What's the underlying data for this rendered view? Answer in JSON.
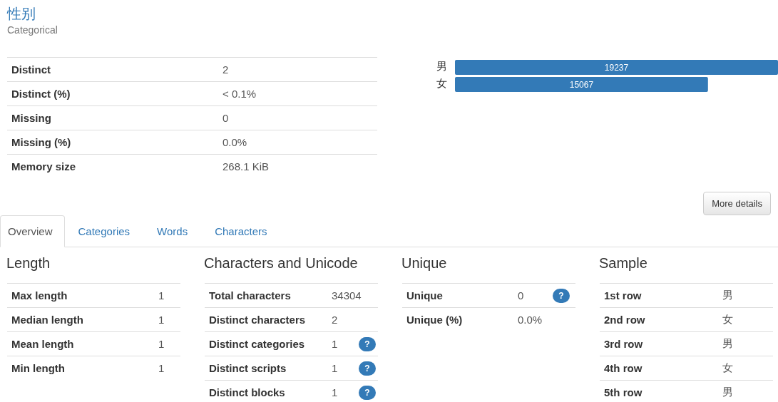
{
  "variable": {
    "name": "性别",
    "type": "Categorical"
  },
  "stats": [
    {
      "label": "Distinct",
      "value": "2"
    },
    {
      "label": "Distinct (%)",
      "value": "< 0.1%"
    },
    {
      "label": "Missing",
      "value": "0"
    },
    {
      "label": "Missing (%)",
      "value": "0.0%"
    },
    {
      "label": "Memory size",
      "value": "268.1 KiB"
    }
  ],
  "chart_data": {
    "type": "bar",
    "orientation": "horizontal",
    "categories": [
      "男",
      "女"
    ],
    "values": [
      19237,
      15067
    ],
    "data_labels": true
  },
  "more_details_button": "More details",
  "tabs": [
    {
      "label": "Overview",
      "selected": true
    },
    {
      "label": "Categories",
      "selected": false
    },
    {
      "label": "Words",
      "selected": false
    },
    {
      "label": "Characters",
      "selected": false
    }
  ],
  "sections": [
    {
      "title": "Length",
      "rows": [
        {
          "label": "Max length",
          "value": "1"
        },
        {
          "label": "Median length",
          "value": "1"
        },
        {
          "label": "Mean length",
          "value": "1"
        },
        {
          "label": "Min length",
          "value": "1"
        }
      ]
    },
    {
      "title": "Characters and Unicode",
      "rows": [
        {
          "label": "Total characters",
          "value": "34304"
        },
        {
          "label": "Distinct characters",
          "value": "2"
        },
        {
          "label": "Distinct categories",
          "value": "1",
          "help": "?"
        },
        {
          "label": "Distinct scripts",
          "value": "1",
          "help": "?"
        },
        {
          "label": "Distinct blocks",
          "value": "1",
          "help": "?"
        }
      ]
    },
    {
      "title": "Unique",
      "rows": [
        {
          "label": "Unique",
          "value": "0",
          "help": "?"
        },
        {
          "label": "Unique (%)",
          "value": "0.0%"
        }
      ]
    },
    {
      "title": "Sample",
      "rows": [
        {
          "label": "1st row",
          "value": "男"
        },
        {
          "label": "2nd row",
          "value": "女"
        },
        {
          "label": "3rd row",
          "value": "男"
        },
        {
          "label": "4th row",
          "value": "女"
        },
        {
          "label": "5th row",
          "value": "男"
        }
      ]
    }
  ]
}
